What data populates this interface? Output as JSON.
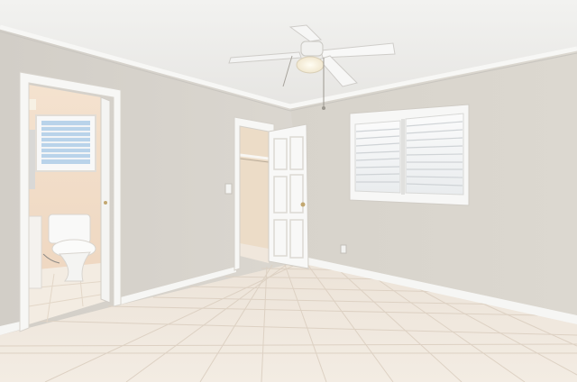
{
  "scene": {
    "room": "empty bedroom",
    "features": [
      "ceiling-fan",
      "ceiling-light",
      "shuttered-window",
      "open-closet-door",
      "walk-in-closet",
      "bathroom-doorway",
      "toilet",
      "tile-floor",
      "crown-molding",
      "baseboard"
    ]
  },
  "colors": {
    "ceiling": "#efefed",
    "wall_right": "#d9d5cd",
    "wall_left": "#d6d2cb",
    "floor": "#efe6dc",
    "trim": "#f7f7f5",
    "bathroom_wall": "#f2dcc6",
    "closet_wall": "#ecdcc7"
  }
}
